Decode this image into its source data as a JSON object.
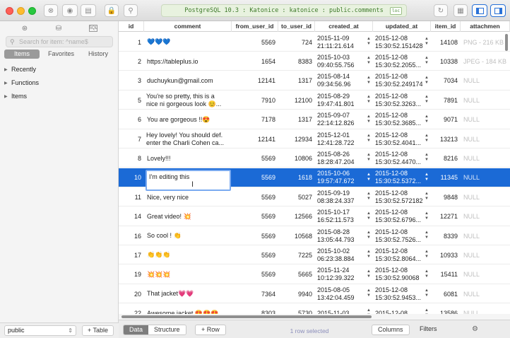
{
  "toolbar": {
    "connection": "PostgreSQL 10.3 : Katonice : katonice : public.comments",
    "badge": "loc"
  },
  "sidebar": {
    "search_placeholder": "Search for item: ^name$",
    "tabs": [
      "Items",
      "Favorites",
      "History"
    ],
    "tree": [
      "Recently",
      "Functions",
      "Items"
    ],
    "schema": "public",
    "add_table": "+ Table"
  },
  "grid": {
    "columns": [
      "id",
      "comment",
      "from_user_id",
      "to_user_id",
      "created_at",
      "updated_at",
      "item_id",
      "attachmen"
    ],
    "rows": [
      {
        "id": "1",
        "comment": "💙💙💙",
        "from": "5569",
        "to": "724",
        "created": [
          "2015-11-09",
          "21:11:21.614"
        ],
        "updated": [
          "2015-12-08",
          "15:30:52.151428"
        ],
        "item": "14108",
        "attach": "PNG - 216 KB"
      },
      {
        "id": "2",
        "comment": "https://tableplus.io",
        "from": "1654",
        "to": "8383",
        "created": [
          "2015-10-03",
          "09:40:55.756"
        ],
        "updated": [
          "2015-12-08",
          "15:30:52.2055..."
        ],
        "item": "10338",
        "attach": "JPEG - 184 KB"
      },
      {
        "id": "3",
        "comment": "duchuykun@gmail.com",
        "from": "12141",
        "to": "1317",
        "created": [
          "2015-08-14",
          "09:34:56.96"
        ],
        "updated": [
          "2015-12-08",
          "15:30:52.249174"
        ],
        "item": "7034",
        "attach": "NULL"
      },
      {
        "id": "5",
        "comment": "You're so pretty, this is a|nice ni gorgeous look 😊...",
        "from": "7910",
        "to": "12100",
        "created": [
          "2015-08-29",
          "19:47:41.801"
        ],
        "updated": [
          "2015-12-08",
          "15:30:52.3263..."
        ],
        "item": "7891",
        "attach": "NULL"
      },
      {
        "id": "6",
        "comment": "You are gorgeous !!😍",
        "from": "7178",
        "to": "1317",
        "created": [
          "2015-09-07",
          "22:14:12.826"
        ],
        "updated": [
          "2015-12-08",
          "15:30:52.3685..."
        ],
        "item": "9071",
        "attach": "NULL"
      },
      {
        "id": "7",
        "comment": "Hey lovely! You should def.|enter the Charli Cohen ca...",
        "from": "12141",
        "to": "12934",
        "created": [
          "2015-12-01",
          "12:41:28.722"
        ],
        "updated": [
          "2015-12-08",
          "15:30:52.4041..."
        ],
        "item": "13213",
        "attach": "NULL"
      },
      {
        "id": "8",
        "comment": "Lovely!!!",
        "from": "5569",
        "to": "10806",
        "created": [
          "2015-08-26",
          "18:28:47.204"
        ],
        "updated": [
          "2015-12-08",
          "15:30:52.4470..."
        ],
        "item": "8216",
        "attach": "NULL"
      },
      {
        "id": "10",
        "comment": "I'm editing this",
        "from": "5569",
        "to": "1618",
        "created": [
          "2015-10-06",
          "19:57:47.672"
        ],
        "updated": [
          "2015-12-08",
          "15:30:52.5372..."
        ],
        "item": "11345",
        "attach": "NULL"
      },
      {
        "id": "11",
        "comment": "Nice, very nice",
        "from": "5569",
        "to": "5027",
        "created": [
          "2015-09-19",
          "08:38:24.337"
        ],
        "updated": [
          "2015-12-08",
          "15:30:52.572182"
        ],
        "item": "9848",
        "attach": "NULL"
      },
      {
        "id": "14",
        "comment": "Great video! 💥",
        "from": "5569",
        "to": "12566",
        "created": [
          "2015-10-17",
          "16:52:11.573"
        ],
        "updated": [
          "2015-12-08",
          "15:30:52.6796..."
        ],
        "item": "12271",
        "attach": "NULL"
      },
      {
        "id": "16",
        "comment": "So cool ! 👏",
        "from": "5569",
        "to": "10568",
        "created": [
          "2015-08-28",
          "13:05:44.793"
        ],
        "updated": [
          "2015-12-08",
          "15:30:52.7526..."
        ],
        "item": "8339",
        "attach": "NULL"
      },
      {
        "id": "17",
        "comment": "👏👏👏",
        "from": "5569",
        "to": "7225",
        "created": [
          "2015-10-02",
          "06:23:38.884"
        ],
        "updated": [
          "2015-12-08",
          "15:30:52.8064..."
        ],
        "item": "10933",
        "attach": "NULL"
      },
      {
        "id": "19",
        "comment": "💥💥💥",
        "from": "5569",
        "to": "5665",
        "created": [
          "2015-11-24",
          "10:12:39.322"
        ],
        "updated": [
          "2015-12-08",
          "15:30:52.90068"
        ],
        "item": "15411",
        "attach": "NULL"
      },
      {
        "id": "20",
        "comment": "That jacket💗💗",
        "from": "7364",
        "to": "9940",
        "created": [
          "2015-08-05",
          "13:42:04.459"
        ],
        "updated": [
          "2015-12-08",
          "15:30:52.9453..."
        ],
        "item": "6081",
        "attach": "NULL"
      },
      {
        "id": "22",
        "comment": "Awesome jacket 😍😍😍",
        "from": "8303",
        "to": "5730",
        "created": [
          "2015-11-03",
          ""
        ],
        "updated": [
          "2015-12-08",
          ""
        ],
        "item": "13586",
        "attach": "NULL"
      }
    ],
    "selected_index": 7
  },
  "bottom": {
    "tabs": [
      "Data",
      "Structure"
    ],
    "add_row": "+ Row",
    "status": "1 row selected",
    "columns": "Columns",
    "filters": "Filters"
  }
}
